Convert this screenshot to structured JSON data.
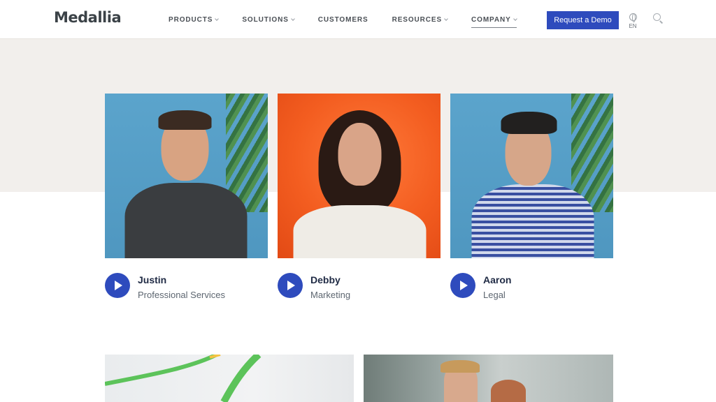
{
  "brand": {
    "logo_text": "Medallia",
    "accent": "#2e4bbd"
  },
  "nav": {
    "items": [
      {
        "label": "PRODUCTS",
        "dropdown": true
      },
      {
        "label": "SOLUTIONS",
        "dropdown": true
      },
      {
        "label": "CUSTOMERS",
        "dropdown": false
      },
      {
        "label": "RESOURCES",
        "dropdown": true
      },
      {
        "label": "COMPANY",
        "dropdown": true,
        "active": true
      }
    ],
    "demo_label": "Request a Demo",
    "language": "EN"
  },
  "hero": {
    "band_color": "#f2efec"
  },
  "videos": [
    {
      "name": "Justin",
      "role": "Professional Services",
      "background": "blue"
    },
    {
      "name": "Debby",
      "role": "Marketing",
      "background": "orange"
    },
    {
      "name": "Aaron",
      "role": "Legal",
      "background": "blue"
    }
  ]
}
